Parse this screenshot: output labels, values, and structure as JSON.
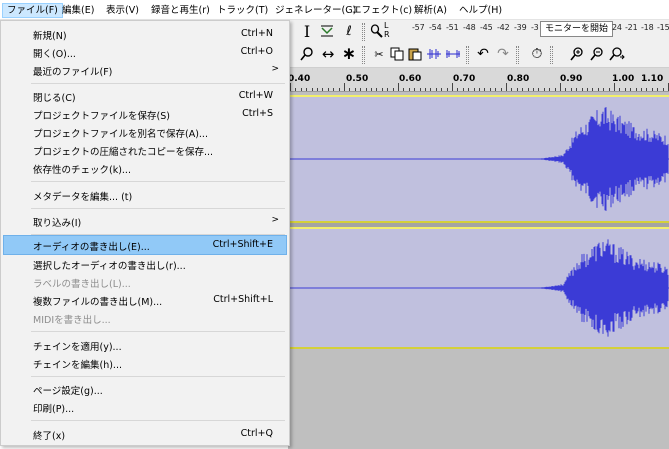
{
  "menubar": {
    "items": [
      {
        "label": "ファイル(F)",
        "active": true
      },
      {
        "label": "編集(E)"
      },
      {
        "label": "表示(V)"
      },
      {
        "label": "録音と再生(r)"
      },
      {
        "label": "トラック(T)"
      },
      {
        "label": "ジェネレーター(G)"
      },
      {
        "label": "エフェクト(c)"
      },
      {
        "label": "解析(A)"
      },
      {
        "label": "ヘルプ(H)"
      }
    ]
  },
  "file_menu": {
    "items": [
      {
        "label": "新規(N)",
        "shortcut": "Ctrl+N"
      },
      {
        "label": "開く(O)...",
        "shortcut": "Ctrl+O"
      },
      {
        "label": "最近のファイル(F)",
        "submenu": ">"
      },
      {
        "label": "閉じる(C)",
        "shortcut": "Ctrl+W"
      },
      {
        "label": "プロジェクトファイルを保存(S)",
        "shortcut": "Ctrl+S"
      },
      {
        "label": "プロジェクトファイルを別名で保存(A)..."
      },
      {
        "label": "プロジェクトの圧縮されたコピーを保存..."
      },
      {
        "label": "依存性のチェック(k)..."
      },
      {
        "label": "メタデータを編集... (t)"
      },
      {
        "label": "取り込み(I)",
        "submenu": ">"
      },
      {
        "label": "オーディオの書き出し(E)...",
        "shortcut": "Ctrl+Shift+E",
        "highlighted": true
      },
      {
        "label": "選択したオーディオの書き出し(r)..."
      },
      {
        "label": "ラベルの書き出し(L)...",
        "disabled": true
      },
      {
        "label": "複数ファイルの書き出し(M)...",
        "shortcut": "Ctrl+Shift+L"
      },
      {
        "label": "MIDIを書き出し...",
        "disabled": true
      },
      {
        "label": "チェインを適用(y)..."
      },
      {
        "label": "チェインを編集(h)..."
      },
      {
        "label": "ページ設定(g)..."
      },
      {
        "label": "印刷(P)..."
      },
      {
        "label": "終了(x)",
        "shortcut": "Ctrl+Q"
      }
    ]
  },
  "toolbar": {
    "meter_channel_l": "L",
    "meter_channel_r": "R",
    "meter_ticks": [
      "-57",
      "-54",
      "-51",
      "-48",
      "-45",
      "-42",
      "-39",
      "-3"
    ],
    "meter_ticks_right": [
      "24",
      "-21",
      "-18",
      "-15"
    ],
    "monitor_button": "モニターを開始"
  },
  "ruler": {
    "labels": [
      "0.40",
      "0.50",
      "0.60",
      "0.70",
      "0.80",
      "0.90",
      "1.00",
      "1.10"
    ]
  },
  "colors": {
    "menu_highlight": "#91c9f7",
    "waveform": "#3b3bd6",
    "track_background": "#c0c0de",
    "track_border": "#f2ef6a"
  }
}
